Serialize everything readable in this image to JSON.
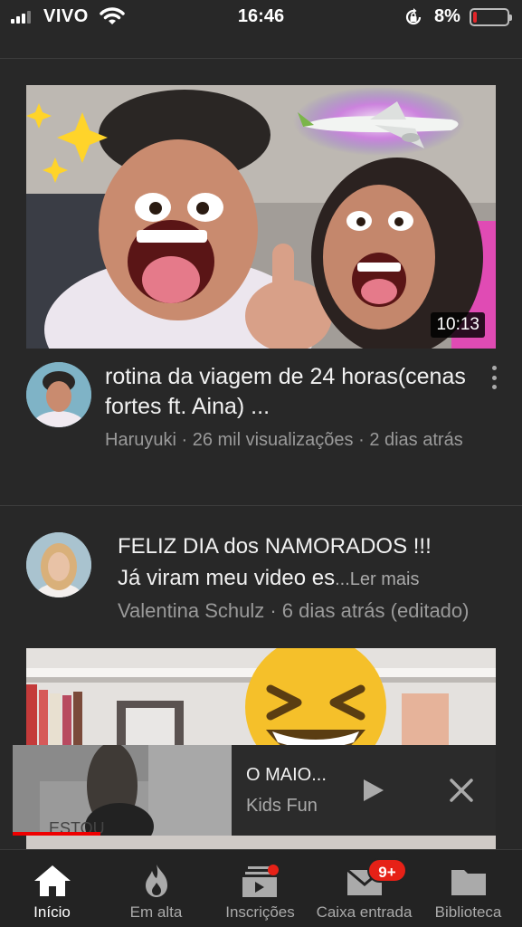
{
  "status_bar": {
    "carrier": "VIVO",
    "time": "16:46",
    "battery_percent": "8%",
    "battery_level": 0.08,
    "battery_color": "#e2262a"
  },
  "feed": {
    "video": {
      "title": "rotina da viagem de 24 horas(cenas fortes ft. Aina) ...",
      "meta": "Haruyuki · 26 mil visualizações · 2 dias atrás",
      "duration": "10:13",
      "thumbnail_icon": "airplane-icon"
    },
    "post": {
      "text_line1": "FELIZ DIA dos NAMORADOS !!!",
      "text_line2": "Já viram meu video es",
      "read_more": "...Ler mais",
      "meta": "Valentina Schulz · 6 dias atrás (editado)"
    }
  },
  "mini_player": {
    "title": "O MAIO...",
    "channel": "Kids Fun",
    "progress": 0.4,
    "progress_color": "#ee0000"
  },
  "bottom_nav": {
    "items": [
      {
        "label": "Início",
        "icon": "home-icon",
        "active": true
      },
      {
        "label": "Em alta",
        "icon": "flame-icon",
        "active": false
      },
      {
        "label": "Inscrições",
        "icon": "subscriptions-icon",
        "active": false
      },
      {
        "label": "Caixa entrada",
        "icon": "inbox-icon",
        "active": false
      },
      {
        "label": "Biblioteca",
        "icon": "library-folder-icon",
        "active": false
      }
    ],
    "inbox_badge": "9+"
  },
  "colors": {
    "background": "#282828",
    "accent_red": "#e62117"
  }
}
